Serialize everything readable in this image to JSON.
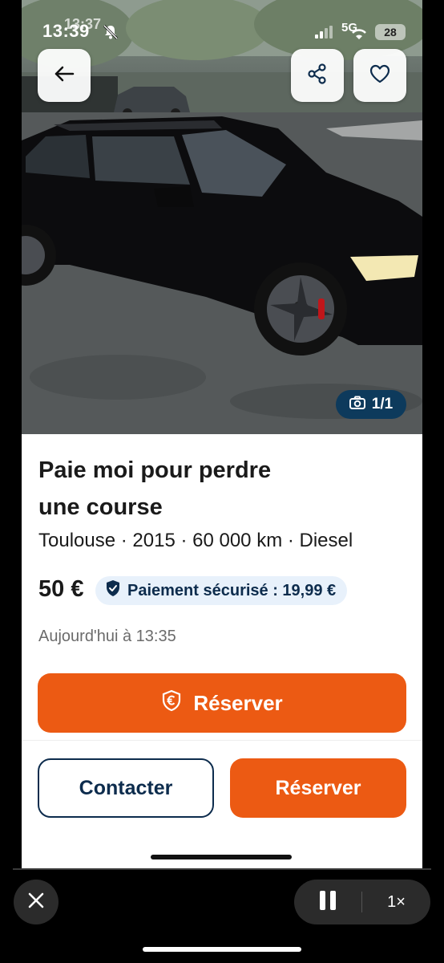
{
  "status_bar": {
    "time": "13:39",
    "time_ghost": "13:37",
    "network": "5G",
    "battery": "28"
  },
  "photo": {
    "counter": "1/1"
  },
  "listing": {
    "title_line1": "Paie moi pour perdre",
    "title_line2": "une course",
    "subtitle": "Toulouse · 2015 · 60 000 km · Diesel",
    "price": "50 €",
    "secure_payment": "Paiement sécurisé : 19,99 €",
    "date": "Aujourd'hui à 13:35"
  },
  "actions": {
    "reserve_main": "Réserver",
    "contact": "Contacter",
    "reserve_secondary": "Réserver"
  },
  "player": {
    "speed": "1×"
  },
  "colors": {
    "accent_orange": "#ec5a13",
    "navy": "#0d2c4d",
    "badge_bg": "#e8f1fb",
    "counter_bg": "#0d3a5c"
  }
}
